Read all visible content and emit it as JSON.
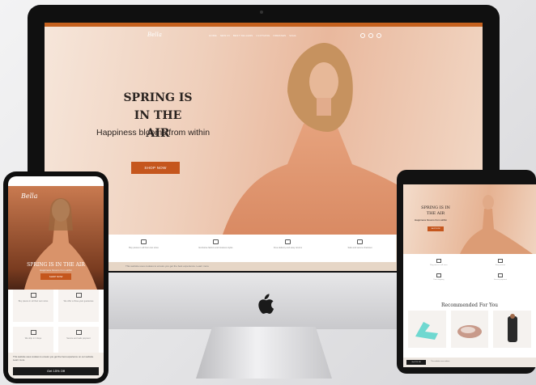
{
  "desktop": {
    "brand": "Bella",
    "nav_links": [
      "HOME",
      "NEW IN",
      "BEST SELLERS",
      "CLOTHING",
      "DRESSES",
      "SALE"
    ],
    "hero_title_line1": "SPRING IS",
    "hero_title_line2": "IN THE AIR",
    "hero_subtitle": "Happiness blooms from within",
    "shop_button": "SHOP NOW",
    "features": [
      "Buy pieces in all their own sizes",
      "Exclusive fabrics and timeless styles",
      "Free delivery and easy returns",
      "Safe and secure checkout"
    ],
    "cookie_notice": "This website uses cookies to ensure you get the best experience. Learn more"
  },
  "phone": {
    "brand": "Bella",
    "hero_title": "SPRING IS IN THE AIR",
    "hero_subtitle": "Happiness blooms from within",
    "shop_button": "SHOP NOW",
    "features": [
      "Buy pieces in all their own sizes",
      "We offer a three-year guarantee",
      "We ship in 2 days",
      "Secure and safe payment"
    ],
    "cookie_text": "This website uses cookies to ensure you get the best experience on our website. Learn more",
    "cookie_button": "Get 15% Off"
  },
  "tablet": {
    "hero_title": "SPRING IS IN THE AIR",
    "hero_subtitle": "Happiness blooms from within",
    "shop_button": "SHOP NOW",
    "features": [
      "Buy pieces in all sizes",
      "Easy returns",
      "Fast shipping",
      "Secure payment"
    ],
    "recommended_title": "Recommended For You",
    "cookie_button": "Get 15% Off",
    "cookie_text": "This website uses cookies."
  },
  "colors": {
    "accent": "#c5561d",
    "screen_bg": "#f2e3d6"
  }
}
